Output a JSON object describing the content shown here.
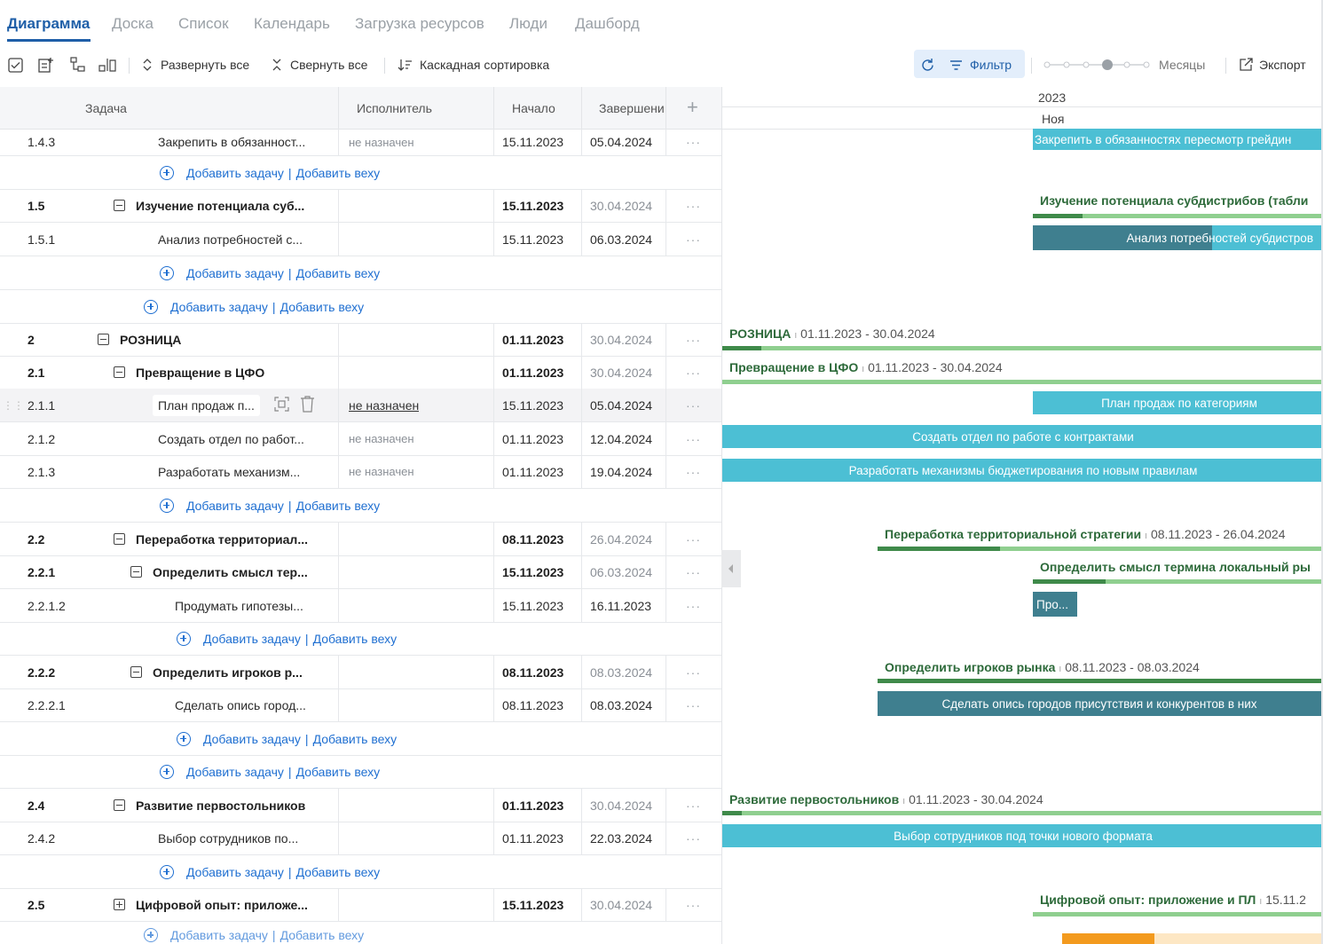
{
  "tabs": [
    "Диаграмма",
    "Доска",
    "Список",
    "Календарь",
    "Загрузка ресурсов",
    "Люди",
    "Дашборд"
  ],
  "toolbar": {
    "expand_all": "Развернуть все",
    "collapse_all": "Свернуть все",
    "cascade_sort": "Каскадная сортировка",
    "filter": "Фильтр",
    "scale": "Месяцы",
    "export": "Экспорт"
  },
  "columns": {
    "task": "Задача",
    "assignee": "Исполнитель",
    "start": "Начало",
    "end": "Завершени",
    "add": "+"
  },
  "add_row": {
    "add_task": "Добавить задачу",
    "separator": "|",
    "add_milestone": "Добавить веху"
  },
  "rows": [
    {
      "id": "1.4.3",
      "name": "Закрепить в обязанност...",
      "assignee": "не назначен",
      "start": "15.11.2023",
      "end": "05.04.2024",
      "menu": "···"
    },
    {
      "id": "1.5",
      "name": "Изучение потенциала суб...",
      "start": "15.11.2023",
      "end": "30.04.2024",
      "menu": "···"
    },
    {
      "id": "1.5.1",
      "name": "Анализ потребностей с...",
      "start": "15.11.2023",
      "end": "06.03.2024",
      "menu": "···"
    },
    {
      "id": "2",
      "name": "РОЗНИЦА",
      "start": "01.11.2023",
      "end": "30.04.2024",
      "menu": "···"
    },
    {
      "id": "2.1",
      "name": "Превращение в ЦФО",
      "start": "01.11.2023",
      "end": "30.04.2024",
      "menu": "···"
    },
    {
      "id": "2.1.1",
      "name": "План продаж п...",
      "assignee": "не назначен",
      "start": "15.11.2023",
      "end": "05.04.2024",
      "menu": "···"
    },
    {
      "id": "2.1.2",
      "name": "Создать отдел по работ...",
      "assignee": "не назначен",
      "start": "01.11.2023",
      "end": "12.04.2024",
      "menu": "···"
    },
    {
      "id": "2.1.3",
      "name": "Разработать механизм...",
      "assignee": "не назначен",
      "start": "01.11.2023",
      "end": "19.04.2024",
      "menu": "···"
    },
    {
      "id": "2.2",
      "name": "Переработка территориал...",
      "start": "08.11.2023",
      "end": "26.04.2024",
      "menu": "···"
    },
    {
      "id": "2.2.1",
      "name": "Определить смысл тер...",
      "start": "15.11.2023",
      "end": "06.03.2024",
      "menu": "···"
    },
    {
      "id": "2.2.1.2",
      "name": "Продумать гипотезы...",
      "start": "15.11.2023",
      "end": "16.11.2023",
      "menu": "···"
    },
    {
      "id": "2.2.2",
      "name": "Определить игроков р...",
      "start": "08.11.2023",
      "end": "08.03.2024",
      "menu": "···"
    },
    {
      "id": "2.2.2.1",
      "name": "Сделать опись город...",
      "start": "08.11.2023",
      "end": "08.03.2024",
      "menu": "···"
    },
    {
      "id": "2.4",
      "name": "Развитие первостольников",
      "start": "01.11.2023",
      "end": "30.04.2024",
      "menu": "···"
    },
    {
      "id": "2.4.2",
      "name": "Выбор сотрудников по...",
      "start": "01.11.2023",
      "end": "22.03.2024",
      "menu": "···"
    },
    {
      "id": "2.5",
      "name": "Цифровой опыт: приложе...",
      "start": "15.11.2023",
      "end": "30.04.2024",
      "menu": "···"
    }
  ],
  "gantt": {
    "year": "2023",
    "month": "Ноя",
    "bars": [
      "Закрепить в обязанностях пересмотр грейдин",
      "Анализ потребностей субдистров",
      "План продаж по категориям",
      "Создать отдел по работе с контрактами",
      "Разработать механизмы бюджетирования по новым правилам",
      "Про...",
      "Сделать опись городов присутствия и конкурентов в них",
      "Выбор сотрудников под точки нового формата"
    ],
    "groups": [
      {
        "name": "Изучение потенциала субдистрибов (табли",
        "dates": ""
      },
      {
        "name": "РОЗНИЦА",
        "dates": "01.11.2023 - 30.04.2024"
      },
      {
        "name": "Превращение в ЦФО",
        "dates": "01.11.2023 - 30.04.2024"
      },
      {
        "name": "Переработка территориальной стратегии",
        "dates": "08.11.2023 - 26.04.2024"
      },
      {
        "name": "Определить смысл термина локальный ры",
        "dates": ""
      },
      {
        "name": "Определить игроков рынка",
        "dates": "08.11.2023 - 08.03.2024"
      },
      {
        "name": "Развитие первостольников",
        "dates": "01.11.2023 - 30.04.2024"
      },
      {
        "name": "Цифровой опыт: приложение и ПЛ",
        "dates": "15.11.2"
      }
    ],
    "date_sep": "ı"
  },
  "colors": {
    "accent": "#1f5fa8",
    "link": "#1f6fd1",
    "bar_light": "#4cbfd4",
    "bar_dark": "#3f7f8f",
    "group_line": "#8fcf8f",
    "group_progress": "#3f8a4a",
    "group_text": "#2d6a3a"
  }
}
